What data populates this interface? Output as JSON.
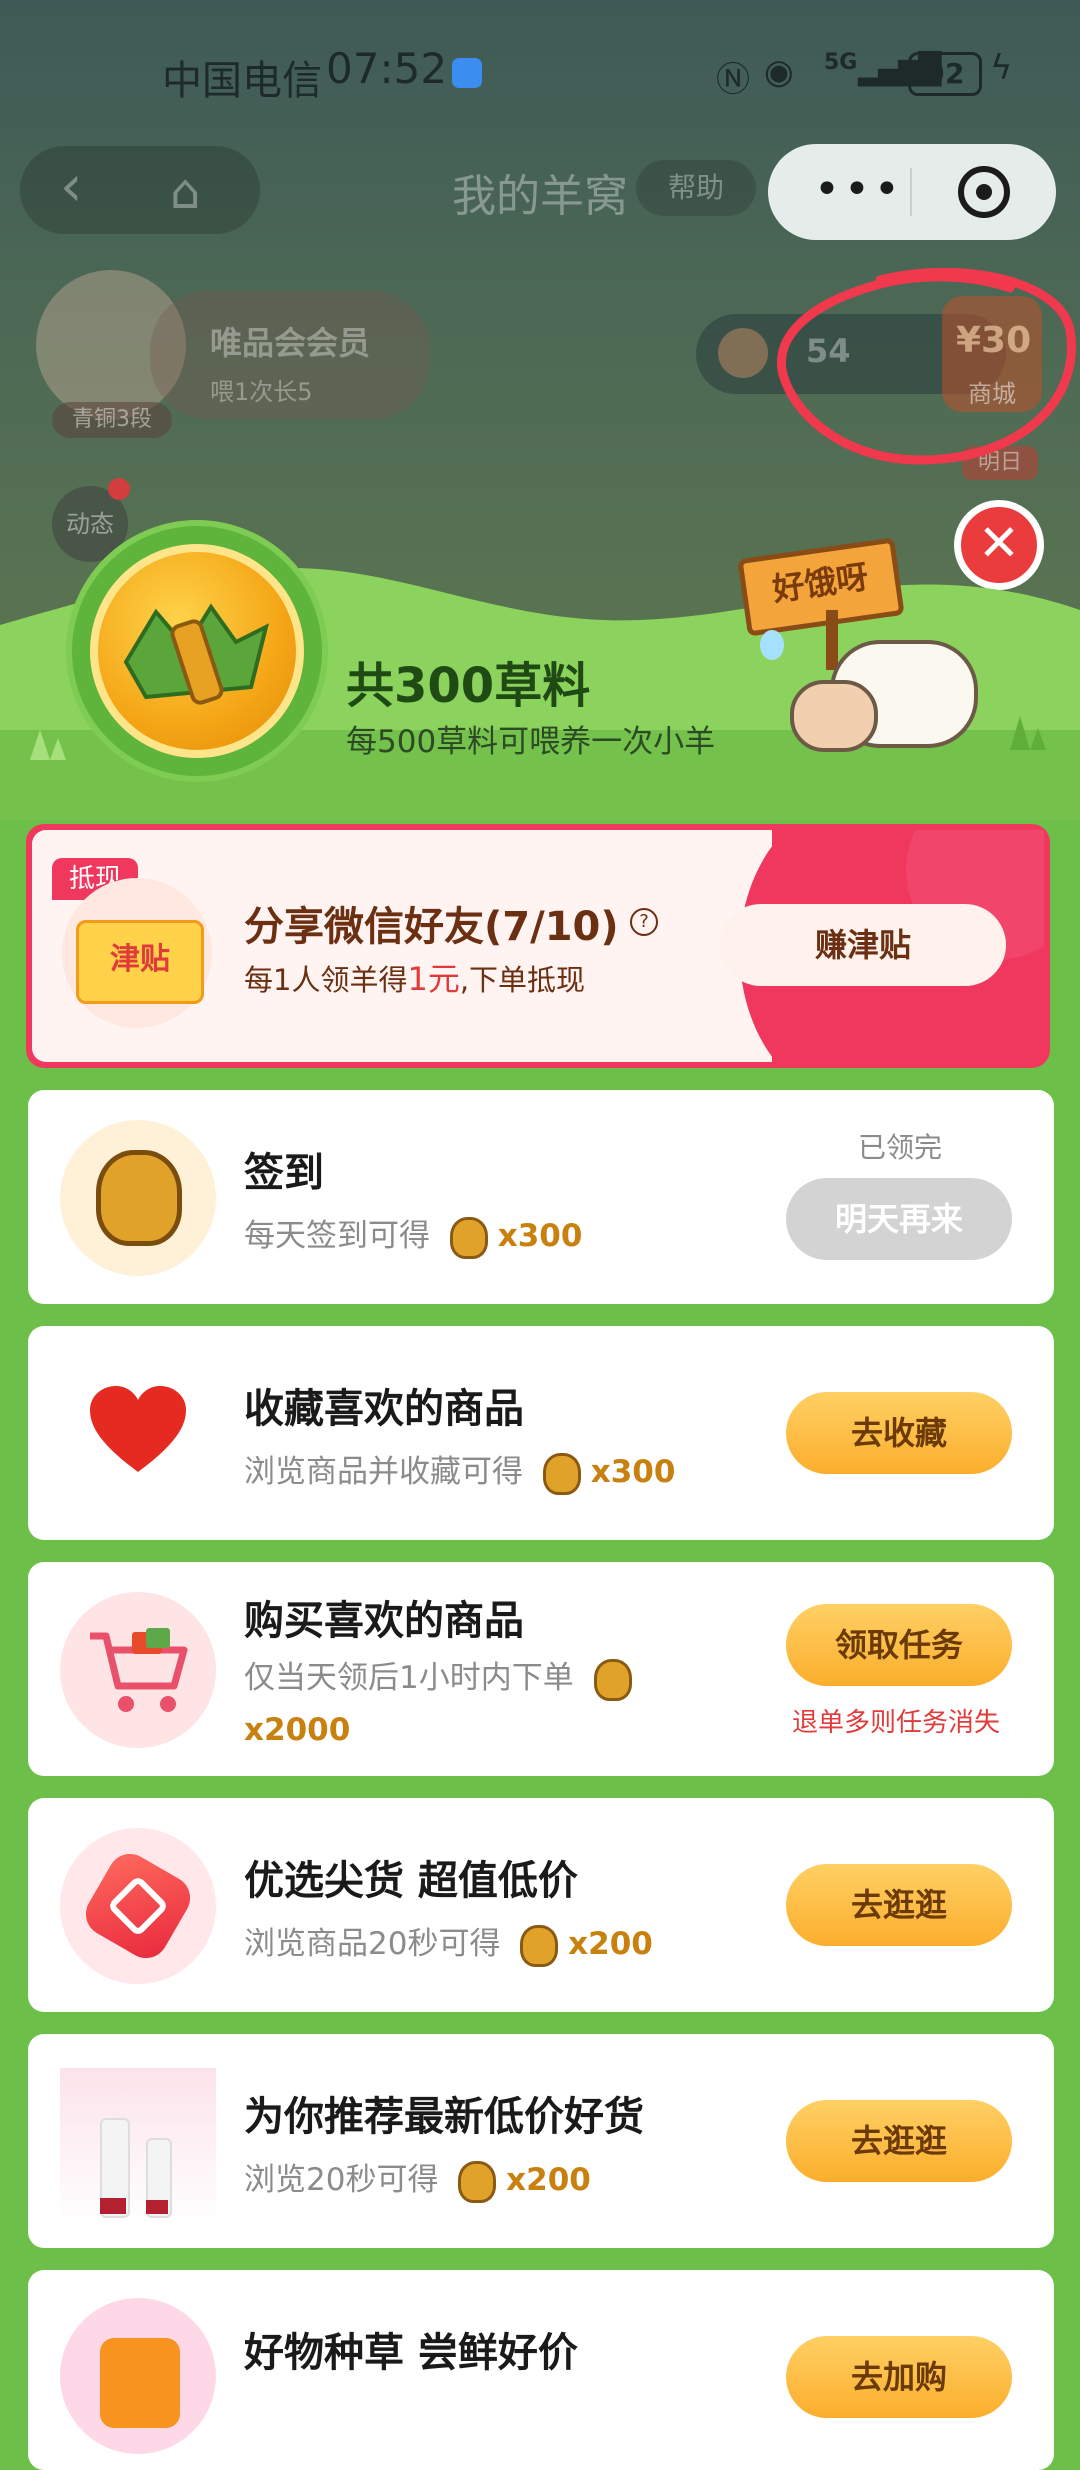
{
  "status_bar": {
    "carrier": "中国电信",
    "time": "07:52",
    "signal": "5G",
    "battery": "92"
  },
  "header": {
    "title": "我的羊窝",
    "help": "帮助"
  },
  "bg_profile": {
    "member_label": "唯品会会员",
    "feed_info": "喂1次长5",
    "rank": "青铜3段",
    "dynamic": "动态",
    "count": "54",
    "mall_price": "¥30",
    "mall_label": "商城",
    "tomorrow": "明日"
  },
  "summary": {
    "total": "共300草料",
    "desc": "每500草料可喂养一次小羊",
    "sign": "好饿呀"
  },
  "share_card": {
    "tag": "抵现",
    "coupon": "津贴",
    "title": "分享微信好友(7/10)",
    "desc_prefix": "每1人领羊得",
    "desc_amount": "1元",
    "desc_suffix": ",下单抵现",
    "button": "赚津贴"
  },
  "tasks": [
    {
      "title": "签到",
      "subtitle": "每天签到可得",
      "reward": "x300",
      "status": "已领完",
      "button": "明天再来"
    },
    {
      "title": "收藏喜欢的商品",
      "subtitle": "浏览商品并收藏可得",
      "reward": "x300",
      "button": "去收藏"
    },
    {
      "title": "购买喜欢的商品",
      "subtitle": "仅当天领后1小时内下单",
      "reward": "x2000",
      "button": "领取任务",
      "note": "退单多则任务消失"
    },
    {
      "title": "优选尖货 超值低价",
      "subtitle": "浏览商品20秒可得",
      "reward": "x200",
      "button": "去逛逛"
    },
    {
      "title": "为你推荐最新低价好货",
      "subtitle": "浏览20秒可得",
      "reward": "x200",
      "button": "去逛逛"
    },
    {
      "title": "好物种草 尝鲜好价",
      "button": "去加购"
    }
  ],
  "colors": {
    "green": "#6cc04a",
    "orange": "#fbae2c",
    "pink": "#f0385e",
    "annotation_red": "#f0394c"
  }
}
